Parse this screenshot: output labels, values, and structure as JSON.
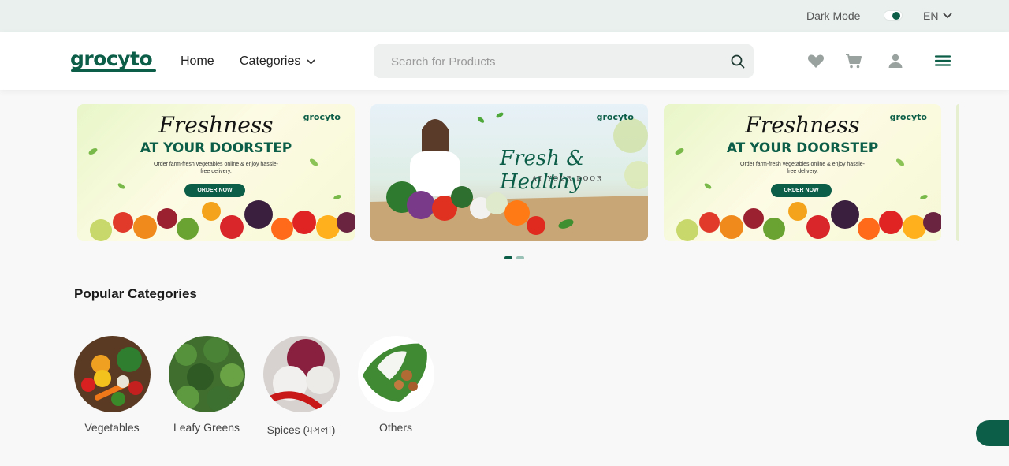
{
  "topbar": {
    "dark_mode_label": "Dark Mode",
    "language": "EN"
  },
  "header": {
    "logo_text": "grocyto",
    "nav": {
      "home": "Home",
      "categories": "Categories"
    },
    "search": {
      "placeholder": "Search for Products"
    }
  },
  "carousel": {
    "banners": [
      {
        "brand": "grocyto",
        "script": "Freshness",
        "headline": "AT YOUR DOORSTEP",
        "subtext": "Order farm-fresh vegetables online & enjoy hassle-free delivery.",
        "cta": "ORDER NOW"
      },
      {
        "brand": "grocyto",
        "script": "Fresh & Healthy",
        "subtext": "AT YOUR DOOR"
      },
      {
        "brand": "grocyto",
        "script": "Freshness",
        "headline": "AT YOUR DOORSTEP",
        "subtext": "Order farm-fresh vegetables online & enjoy hassle-free delivery.",
        "cta": "ORDER NOW"
      }
    ],
    "active_slide": 1,
    "slide_count": 2
  },
  "popular": {
    "title": "Popular Categories",
    "items": [
      {
        "label": "Vegetables"
      },
      {
        "label": "Leafy Greens"
      },
      {
        "label": "Spices (মসলা)"
      },
      {
        "label": "Others"
      }
    ]
  },
  "colors": {
    "brand": "#0d5e48",
    "topbar_bg": "#e9f0ee",
    "page_bg": "#f8f8f8"
  },
  "icons": [
    "toggle-switch",
    "chevron-down-icon",
    "search-icon",
    "heart-icon",
    "cart-icon",
    "user-icon",
    "menu-icon"
  ]
}
